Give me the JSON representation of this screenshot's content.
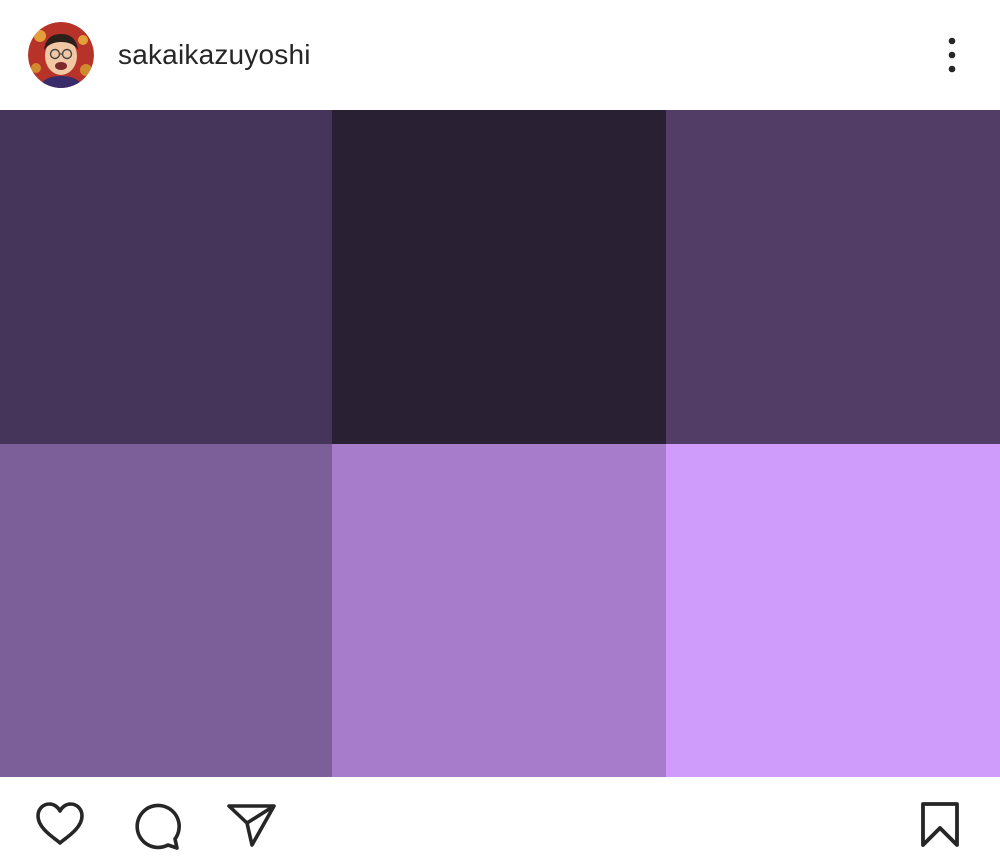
{
  "post": {
    "username": "sakaikazuyoshi",
    "avatar_icon": "profile-photo-icon",
    "more_icon": "more-options-vertical-icon"
  },
  "tiles": [
    {
      "color": "#46355a"
    },
    {
      "color": "#292033"
    },
    {
      "color": "#513d65"
    },
    {
      "color": "#7c5f99"
    },
    {
      "color": "#a77dcb"
    },
    {
      "color": "#d09cfb"
    }
  ],
  "actions": {
    "like_icon": "heart-icon",
    "comment_icon": "comment-icon",
    "share_icon": "send-icon",
    "save_icon": "bookmark-icon"
  }
}
